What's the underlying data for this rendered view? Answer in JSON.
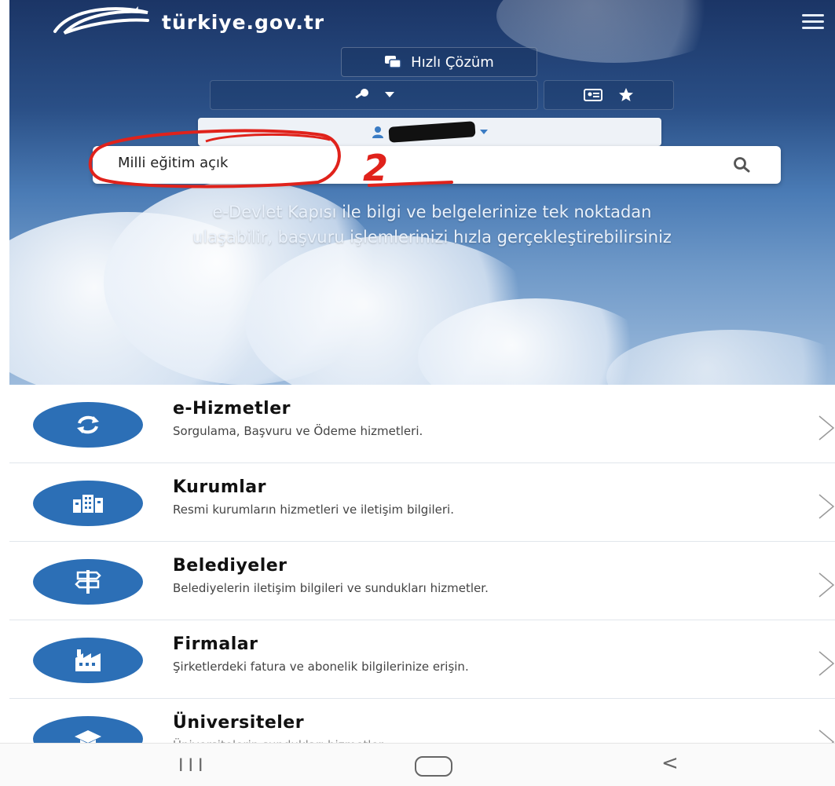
{
  "header": {
    "logo_text": "türkiye.gov.tr",
    "quick_solution_label": "Hızlı Çözüm"
  },
  "search": {
    "value": "Milli eğitim açık"
  },
  "annotation": {
    "number": "2",
    "color": "#e0221b"
  },
  "tagline": {
    "line1": "e-Devlet Kapısı ile bilgi ve belgelerinize tek noktadan",
    "line2": "ulaşabilir, başvuru işlemlerinizi hızla gerçekleştirebilirsiniz"
  },
  "categories": [
    {
      "title": "e-Hizmetler",
      "desc": "Sorgulama, Başvuru ve Ödeme hizmetleri.",
      "icon": "refresh-icon"
    },
    {
      "title": "Kurumlar",
      "desc": "Resmi kurumların hizmetleri ve iletişim bilgileri.",
      "icon": "buildings-icon"
    },
    {
      "title": "Belediyeler",
      "desc": "Belediyelerin iletişim bilgileri ve sundukları hizmetler.",
      "icon": "signpost-icon"
    },
    {
      "title": "Firmalar",
      "desc": "Şirketlerdeki fatura ve abonelik bilgilerinize erişin.",
      "icon": "factory-icon"
    },
    {
      "title": "Üniversiteler",
      "desc": "Üniversitelerin sundukları hizmetler.",
      "icon": "graduation-cap-icon"
    }
  ],
  "navbar": {
    "recent": "III",
    "back": "<"
  },
  "colors": {
    "accent": "#2c6fb6",
    "hero_top": "#1b3566"
  }
}
